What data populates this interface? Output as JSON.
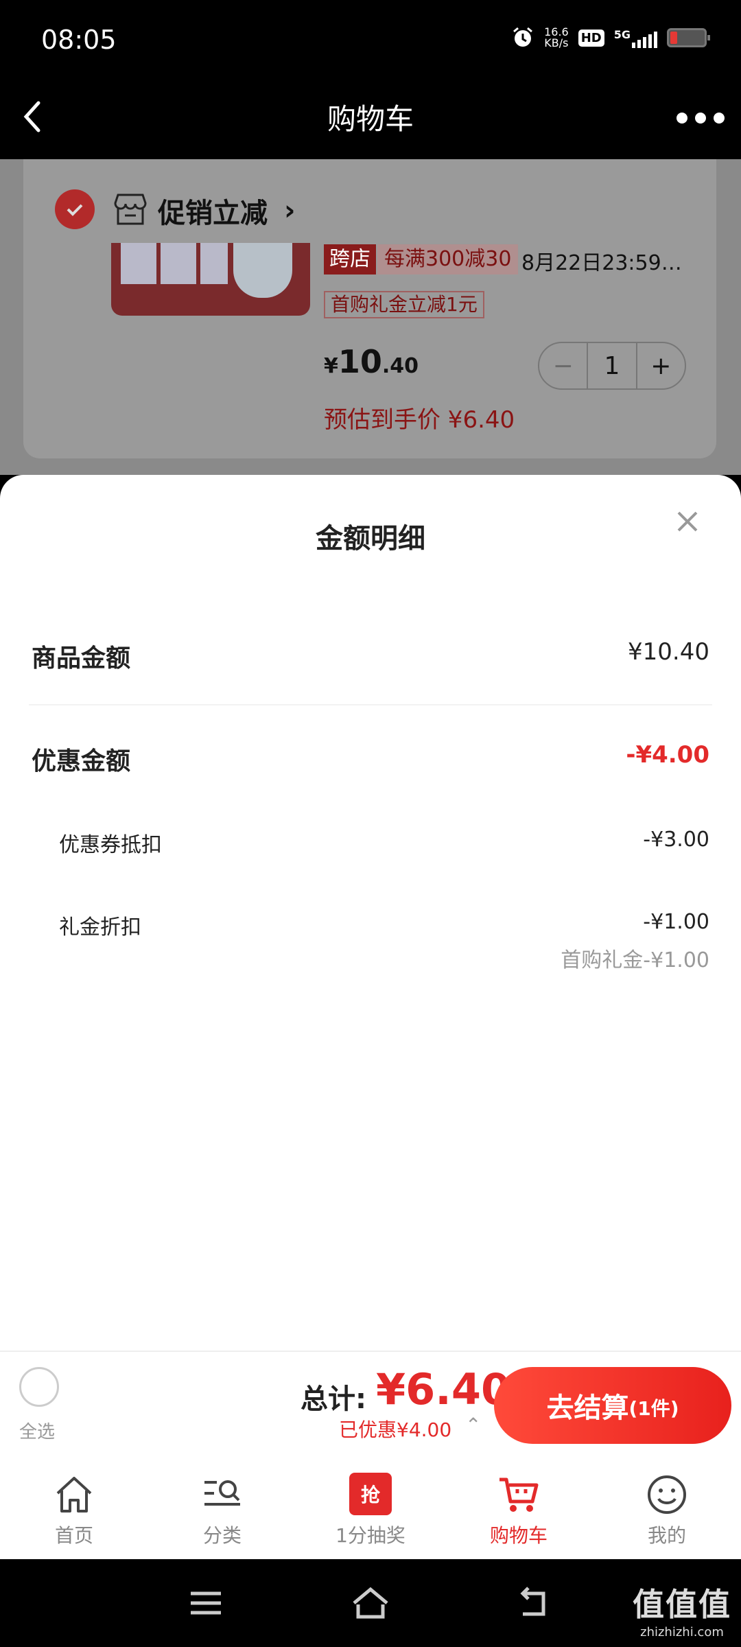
{
  "status_bar": {
    "time": "08:05",
    "net_speed": "16.6",
    "net_unit": "KB/s",
    "hd": "HD",
    "network": "5G"
  },
  "header": {
    "title": "购物车"
  },
  "cart_item": {
    "promo_label": "促销立减",
    "cross_store_tag": "跨店",
    "promo_tag": "每满300减30",
    "deadline": "8月22日23:59…",
    "gift_tag": "首购礼金立减1元",
    "price_symbol": "¥",
    "price_int": "10",
    "price_dec": ".40",
    "quantity": "1",
    "minus": "−",
    "plus": "+",
    "estimated_price": "预估到手价 ¥6.40"
  },
  "sheet": {
    "title": "金额明细",
    "goods_label": "商品金额",
    "goods_value": "¥10.40",
    "discount_label": "优惠金额",
    "discount_value": "-¥4.00",
    "coupon_label": "优惠券抵扣",
    "coupon_value": "-¥3.00",
    "gift_label": "礼金折扣",
    "gift_value": "-¥1.00",
    "gift_note": "首购礼金-¥1.00"
  },
  "checkout": {
    "select_all": "全选",
    "total_label": "总计:",
    "total_value": "¥6.40",
    "saved": "已优惠¥4.00",
    "button_label": "去结算",
    "button_count": "(1件)"
  },
  "tabs": [
    {
      "label": "首页"
    },
    {
      "label": "分类"
    },
    {
      "label": "1分抽奖",
      "badge": "抢"
    },
    {
      "label": "购物车"
    },
    {
      "label": "我的"
    }
  ],
  "watermark": {
    "main": "值值值",
    "sub": "zhizhizhi.com"
  },
  "colors": {
    "accent": "#e32a2a",
    "checkout_gradient_start": "#ff4a3a",
    "checkout_gradient_end": "#e8211d"
  }
}
